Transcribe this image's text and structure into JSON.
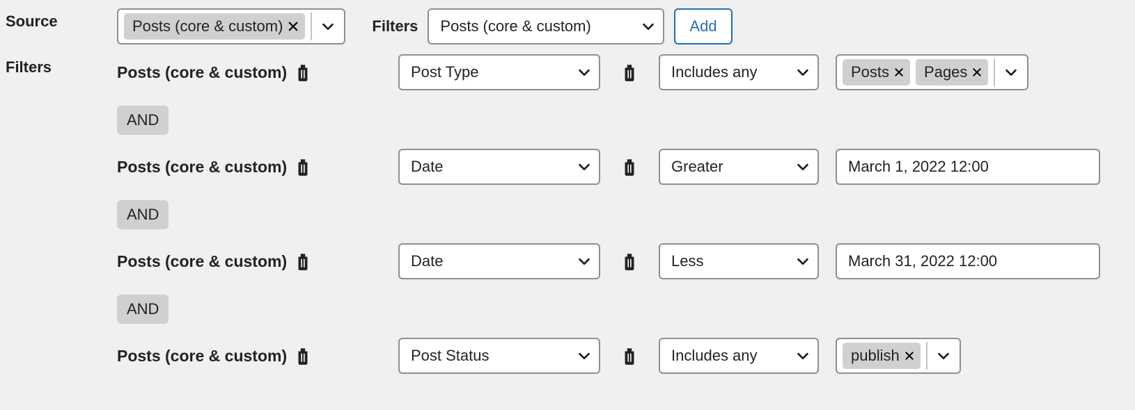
{
  "labels": {
    "source": "Source",
    "filters_top": "Filters",
    "filters_side": "Filters",
    "add": "Add",
    "and": "AND"
  },
  "source_combo": {
    "chip": "Posts (core & custom)"
  },
  "filters_top_select": "Posts (core & custom)",
  "filter_rows": [
    {
      "group": "Posts (core & custom)",
      "field": "Post Type",
      "op": "Includes any",
      "value_type": "chips",
      "chips": [
        "Posts",
        "Pages"
      ]
    },
    {
      "group": "Posts (core & custom)",
      "field": "Date",
      "op": "Greater",
      "value_type": "text",
      "text": "March 1, 2022 12:00"
    },
    {
      "group": "Posts (core & custom)",
      "field": "Date",
      "op": "Less",
      "value_type": "text",
      "text": "March 31, 2022 12:00"
    },
    {
      "group": "Posts (core & custom)",
      "field": "Post Status",
      "op": "Includes any",
      "value_type": "chips",
      "chips": [
        "publish"
      ]
    }
  ]
}
